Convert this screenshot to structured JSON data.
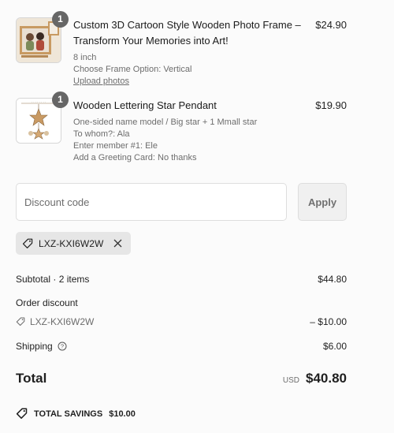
{
  "items": [
    {
      "title": "Custom 3D Cartoon Style Wooden Photo Frame – Transform Your Memories into Art!",
      "quantity": "1",
      "price": "$24.90",
      "meta": [
        "8 inch",
        "Choose Frame Option: Vertical"
      ],
      "link": "Upload photos"
    },
    {
      "title": "Wooden Lettering Star Pendant",
      "quantity": "1",
      "price": "$19.90",
      "meta": [
        "One-sided name model / Big star + 1 Mmall star",
        "To whom?: Ala",
        "Enter member #1: Ele",
        "Add a Greeting Card: No thanks"
      ]
    }
  ],
  "discount": {
    "placeholder": "Discount code",
    "apply_label": "Apply",
    "applied_code": "LXZ-KXI6W2W"
  },
  "summary": {
    "subtotal_label": "Subtotal · 2 items",
    "subtotal_value": "$44.80",
    "order_discount_label": "Order discount",
    "discount_code": "LXZ-KXI6W2W",
    "discount_value": "– $10.00",
    "shipping_label": "Shipping",
    "shipping_value": "$6.00",
    "total_label": "Total",
    "currency": "USD",
    "total_value": "$40.80",
    "savings_label": "TOTAL SAVINGS",
    "savings_value": "$10.00"
  },
  "icons": {
    "tag": "tag-icon",
    "close": "close-icon",
    "info": "info-icon"
  }
}
